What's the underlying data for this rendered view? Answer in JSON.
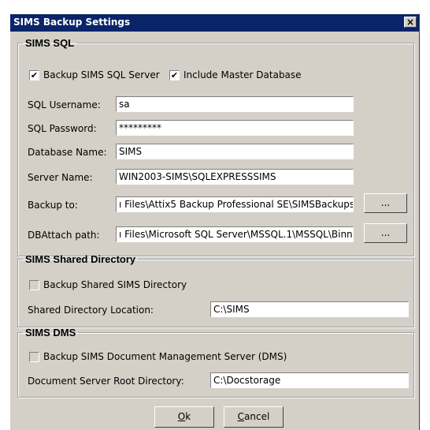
{
  "window": {
    "title": "SIMS Backup Settings",
    "close_glyph": "×"
  },
  "sql": {
    "legend": "SIMS SQL",
    "backup_sql_label": "Backup SIMS SQL Server",
    "backup_sql_checked": true,
    "include_master_label": "Include Master Database",
    "include_master_checked": true,
    "username_label": "SQL Username:",
    "username_value": "sa",
    "password_label": "SQL Password:",
    "password_value": "*********",
    "dbname_label": "Database Name:",
    "dbname_value": "SIMS",
    "server_label": "Server Name:",
    "server_value": "WIN2003-SIMS\\SQLEXPRESSSIMS",
    "backup_to_label": "Backup to:",
    "backup_to_value": "ı Files\\Attix5 Backup Professional SE\\SIMSBackups",
    "dbattach_label": "DBAttach path:",
    "dbattach_value": "ı Files\\Microsoft SQL Server\\MSSQL.1\\MSSQL\\Binn",
    "browse_label": "..."
  },
  "shared": {
    "legend": "SIMS Shared Directory",
    "backup_label": "Backup Shared SIMS Directory",
    "backup_checked": false,
    "location_label": "Shared Directory Location:",
    "location_value": "C:\\SIMS"
  },
  "dms": {
    "legend": "SIMS DMS",
    "backup_label": "Backup SIMS Document Management Server (DMS)",
    "backup_checked": false,
    "root_label": "Document Server Root Directory:",
    "root_value": "C:\\Docstorage"
  },
  "footer": {
    "ok_mnemonic": "O",
    "ok_rest": "k",
    "cancel_mnemonic": "C",
    "cancel_rest": "ancel"
  },
  "check_glyph": "✔"
}
